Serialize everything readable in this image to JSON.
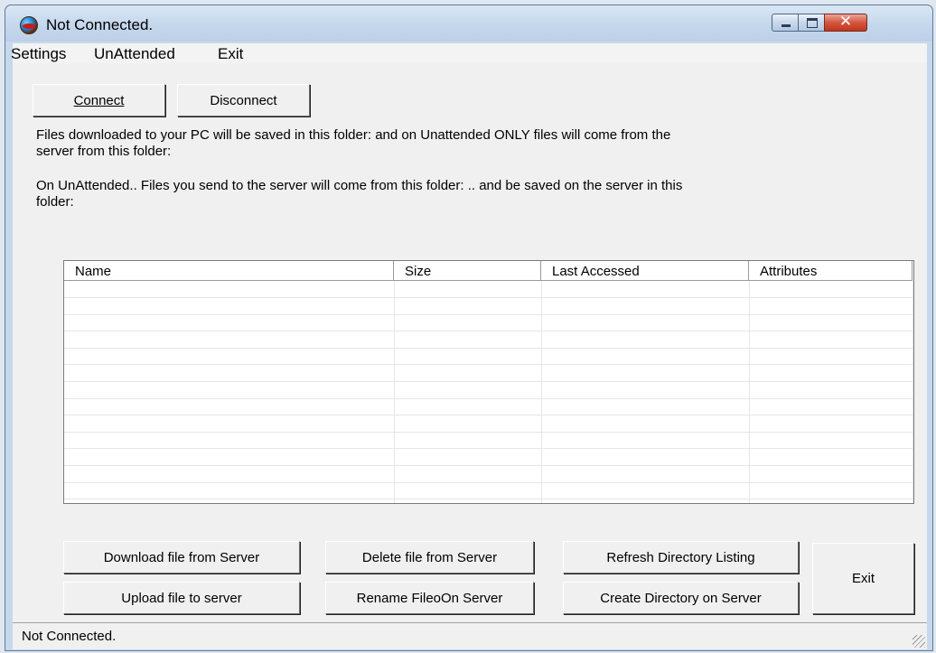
{
  "window": {
    "title": "Not Connected."
  },
  "menu": {
    "items": [
      "Settings",
      "UnAttended",
      "Exit"
    ]
  },
  "toolbar": {
    "connect_label": "Connect",
    "disconnect_label": "Disconnect"
  },
  "info": {
    "line1": "Files downloaded to your PC will be saved in this folder:  and on Unattended ONLY files will come from the",
    "line2": "server from this folder:",
    "line3": "On UnAttended.. Files you send to the server will come from this folder: .. and be saved on the server in this",
    "line4": "folder:"
  },
  "file_list": {
    "columns": [
      "Name",
      "Size",
      "Last Accessed",
      "Attributes"
    ],
    "rows": []
  },
  "actions": {
    "download": "Download file from Server",
    "upload": "Upload file to server",
    "delete": "Delete file from Server",
    "rename": "Rename FileoOn Server",
    "refresh": "Refresh Directory Listing",
    "create_dir": "Create Directory on Server",
    "exit": "Exit"
  },
  "status": {
    "text": "Not Connected."
  }
}
